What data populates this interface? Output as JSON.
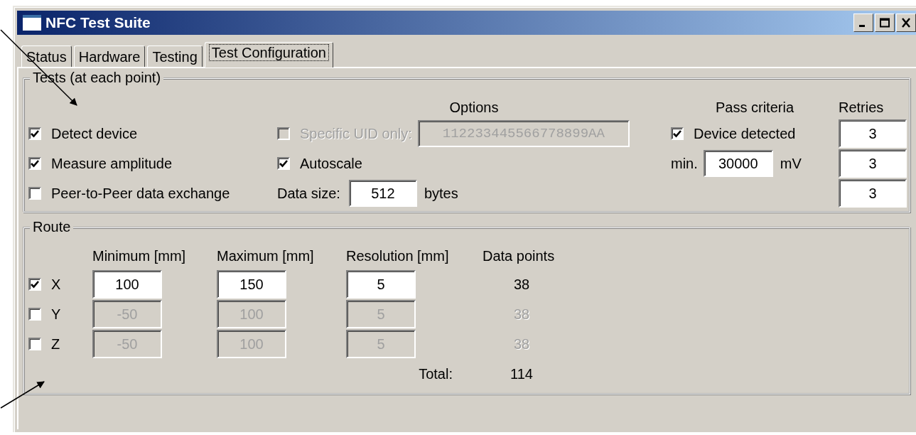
{
  "window": {
    "title": "NFC Test Suite"
  },
  "tabs": [
    {
      "label": "Status",
      "selected": false
    },
    {
      "label": "Hardware",
      "selected": false
    },
    {
      "label": "Testing",
      "selected": false
    },
    {
      "label": "Test Configuration",
      "selected": true
    }
  ],
  "tests": {
    "legend": "Tests (at each point)",
    "options_heading": "Options",
    "pass_heading": "Pass criteria",
    "retries_heading": "Retries",
    "rows": [
      {
        "label": "Detect device",
        "checked": true,
        "option": {
          "kind": "check_field",
          "label": "Specific UID only:",
          "checked": false,
          "disabled": true,
          "value": "112233445566778899AA"
        },
        "pass": {
          "kind": "check",
          "label": "Device detected",
          "checked": true
        },
        "retries": "3"
      },
      {
        "label": "Measure amplitude",
        "checked": true,
        "option": {
          "kind": "check",
          "label": "Autoscale",
          "checked": true
        },
        "pass": {
          "kind": "field",
          "label": "min.",
          "value": "30000",
          "unit": "mV"
        },
        "retries": "3"
      },
      {
        "label": "Peer-to-Peer data exchange",
        "checked": false,
        "option": {
          "kind": "field",
          "label": "Data size:",
          "value": "512",
          "unit": "bytes"
        },
        "retries": "3"
      }
    ]
  },
  "route": {
    "legend": "Route",
    "columns": [
      "Minimum [mm]",
      "Maximum [mm]",
      "Resolution [mm]",
      "Data points"
    ],
    "rows": [
      {
        "axis": "X",
        "checked": true,
        "minimum": "100",
        "maximum": "150",
        "resolution": "5",
        "points": "38"
      },
      {
        "axis": "Y",
        "checked": false,
        "minimum": "-50",
        "maximum": "100",
        "resolution": "5",
        "points": "38"
      },
      {
        "axis": "Z",
        "checked": false,
        "minimum": "-50",
        "maximum": "100",
        "resolution": "5",
        "points": "38"
      }
    ],
    "total_label": "Total:",
    "total": "114"
  }
}
